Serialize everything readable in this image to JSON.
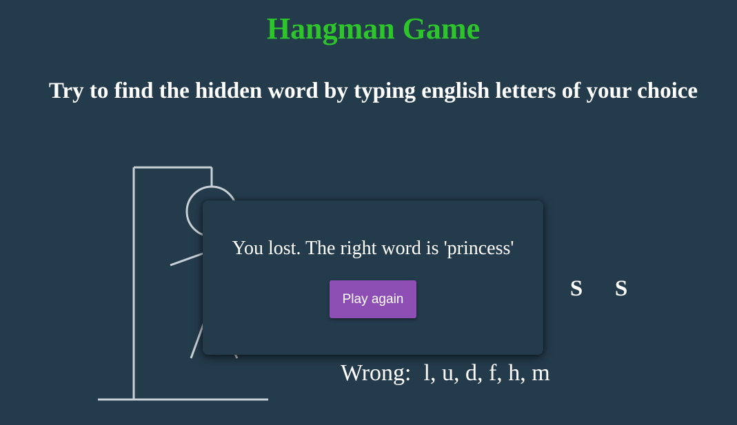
{
  "header": {
    "title": "Hangman Game",
    "subtitle": "Try to find the hidden word by typing english letters of your choice"
  },
  "word": {
    "revealed_letters": [
      "S",
      "S"
    ]
  },
  "wrong": {
    "label": "Wrong:",
    "letters": "l, u, d, f, h, m"
  },
  "popup": {
    "message": "You lost. The right word is 'princess'",
    "button_label": "Play again"
  },
  "colors": {
    "background": "#243b4c",
    "title": "#2ec52b",
    "button": "#8e4fb5",
    "drawing": "#c9d1d8"
  }
}
